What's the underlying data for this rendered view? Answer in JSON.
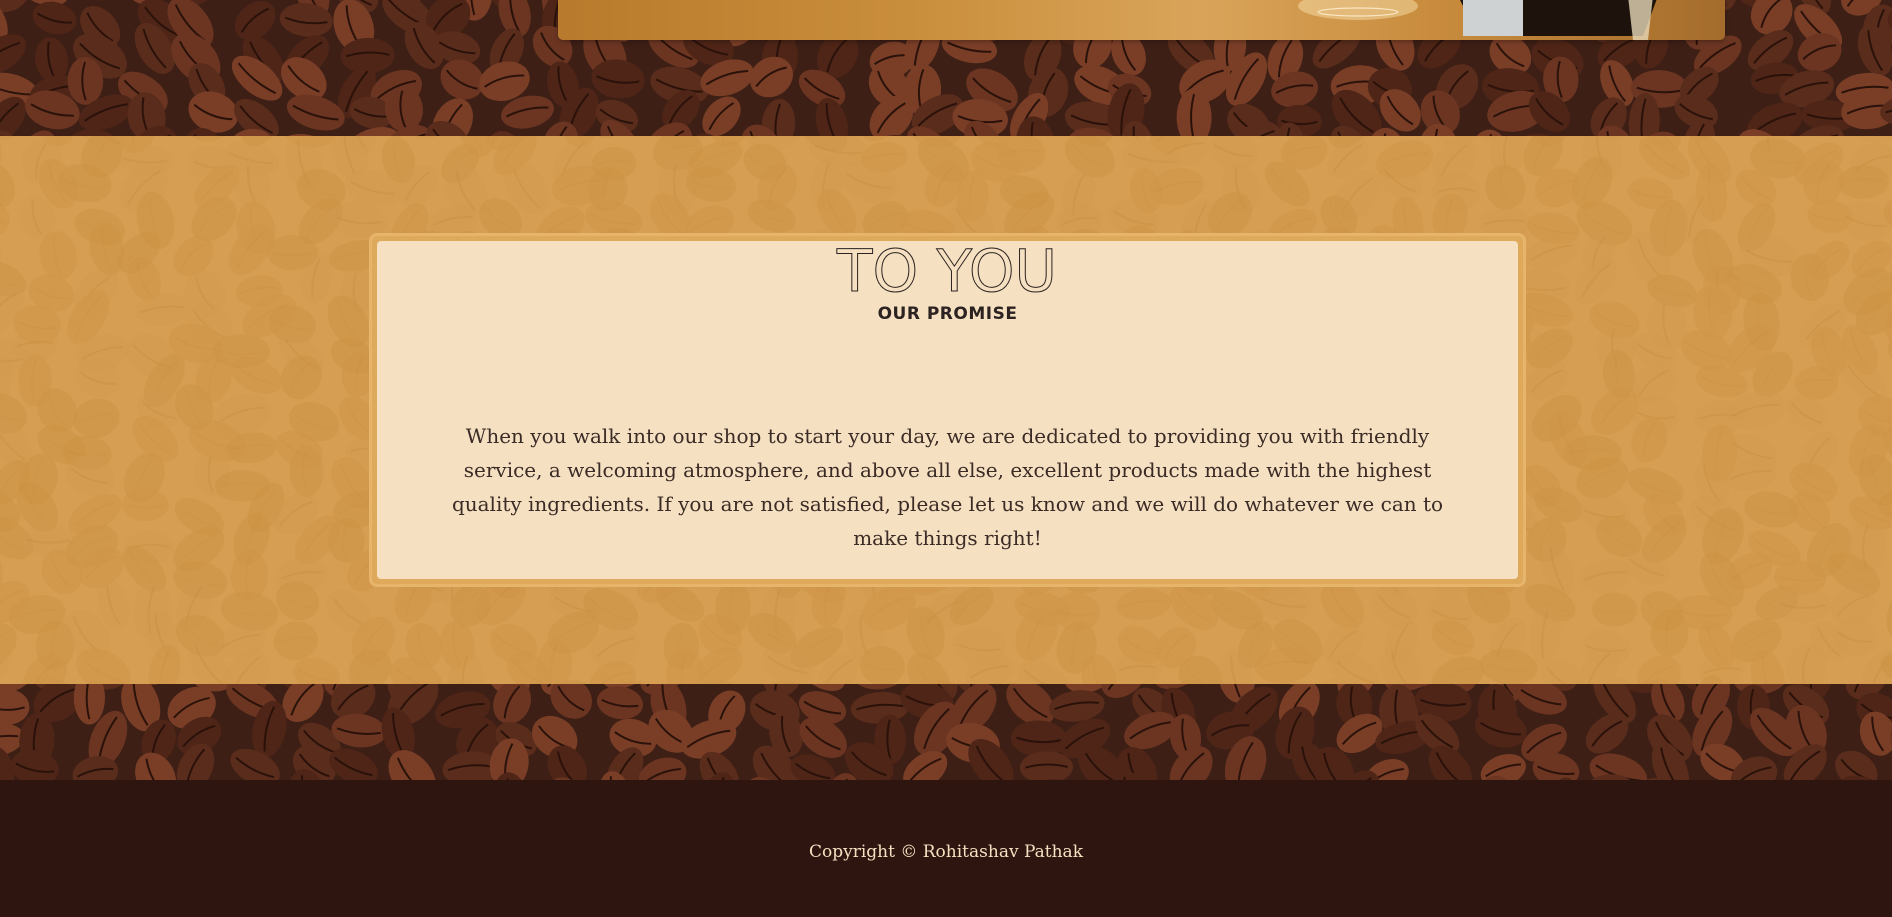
{
  "promise": {
    "subtitle": "OUR PROMISE",
    "title": "TO YOU",
    "body": "When you walk into our shop to start your day, we are dedicated to providing you with friendly service, a welcoming atmosphere, and above all else, excellent products made with the highest quality ingredients. If you are not satisfied, please let us know and we will do whatever we can to make things right!"
  },
  "footer": {
    "copyright": "Copyright © Rohitashav Pathak"
  },
  "colors": {
    "bean_dark": "#3d1f15",
    "section_orange": "#d59e52",
    "card_cream": "#f5e0c1",
    "footer_dark": "#2e150f"
  }
}
